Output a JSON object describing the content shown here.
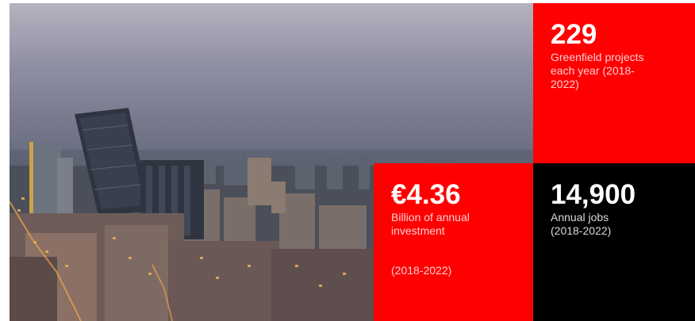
{
  "stats": {
    "greenfield": {
      "value": "229",
      "caption_line1": "Greenfield projects",
      "caption_line2": "each year (2018-",
      "caption_line3": "2022)"
    },
    "investment": {
      "value": "€4.36",
      "caption_line1": "Billion of annual",
      "caption_line2": "investment",
      "caption_line3": "(2018-2022)"
    },
    "jobs": {
      "value": "14,900",
      "caption_line1": "Annual jobs",
      "caption_line2": "(2018-2022)"
    }
  },
  "colors": {
    "red_tile": "#ff0000",
    "black_tile": "#000000",
    "text": "#ffffff"
  }
}
